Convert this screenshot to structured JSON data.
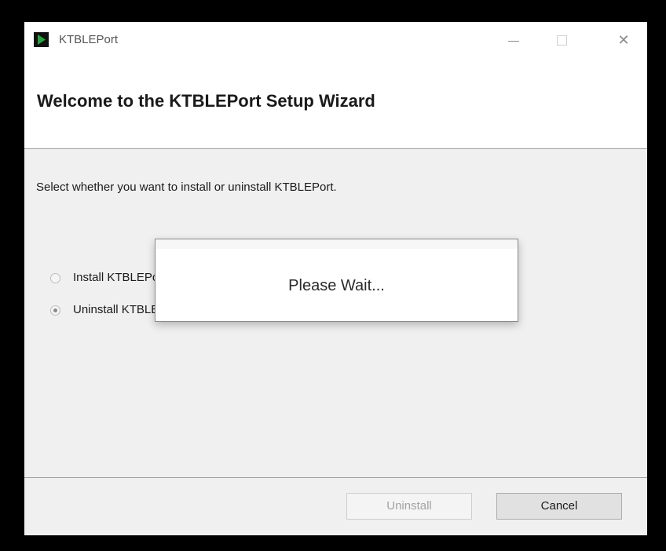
{
  "window": {
    "title": "KTBLEPort",
    "controls": {
      "minimize_icon": "minimize-icon",
      "maximize_icon": "maximize-icon",
      "close_icon": "close-icon",
      "close_glyph": "✕"
    }
  },
  "header": {
    "title": "Welcome to the KTBLEPort Setup Wizard"
  },
  "body": {
    "instruction": "Select whether you want to install or uninstall KTBLEPort.",
    "options": [
      {
        "label": "Install KTBLEPort",
        "selected": false
      },
      {
        "label": "Uninstall KTBLEPort",
        "selected": true
      }
    ]
  },
  "popup": {
    "message": "Please Wait..."
  },
  "footer": {
    "uninstall_label": "Uninstall",
    "uninstall_enabled": false,
    "cancel_label": "Cancel"
  },
  "colors": {
    "app_icon_accent": "#2ea043",
    "window_bg": "#f0f0f0",
    "header_bg": "#ffffff"
  }
}
